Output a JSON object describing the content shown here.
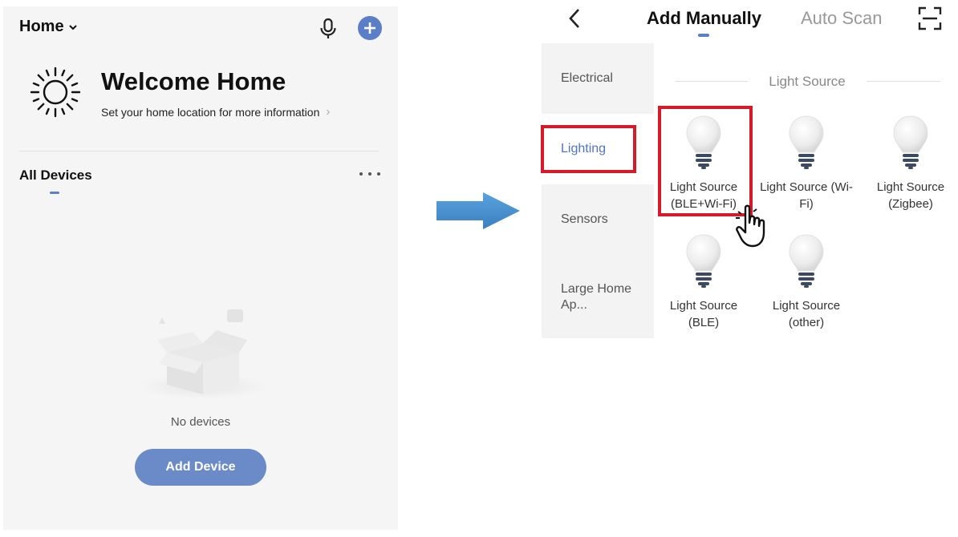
{
  "home_screen": {
    "home_title": "Home",
    "welcome_title": "Welcome Home",
    "location_hint": "Set your home location for more information",
    "all_devices_label": "All Devices",
    "no_devices_text": "No devices",
    "add_device_label": "Add Device"
  },
  "add_device_screen": {
    "tabs": [
      {
        "label": "Add Manually",
        "active": true
      },
      {
        "label": "Auto Scan",
        "active": false
      }
    ],
    "categories": [
      {
        "label": "Electrical",
        "selected": false
      },
      {
        "label": "Lighting",
        "selected": true
      },
      {
        "label": "Sensors",
        "selected": false
      },
      {
        "label": "Large Home Ap...",
        "selected": false
      }
    ],
    "section_title": "Light Source",
    "devices": [
      {
        "label": "Light Source (BLE+Wi-Fi)",
        "highlighted": true
      },
      {
        "label": "Light Source (Wi-Fi)",
        "highlighted": false
      },
      {
        "label": "Light Source (Zigbee)",
        "highlighted": false
      },
      {
        "label": "Light Source (BLE)",
        "highlighted": false
      },
      {
        "label": "Light Source (other)",
        "highlighted": false
      }
    ]
  },
  "colors": {
    "accent": "#5b7ec9",
    "highlight": "#d51b2a",
    "arrow": "#4a8fcf"
  },
  "icons": [
    "chevron-down-icon",
    "mic-icon",
    "plus-icon",
    "sun-icon",
    "more-icon",
    "empty-box-icon",
    "back-icon",
    "scan-icon",
    "bulb-icon",
    "hand-pointer-icon",
    "arrow-right-icon"
  ]
}
